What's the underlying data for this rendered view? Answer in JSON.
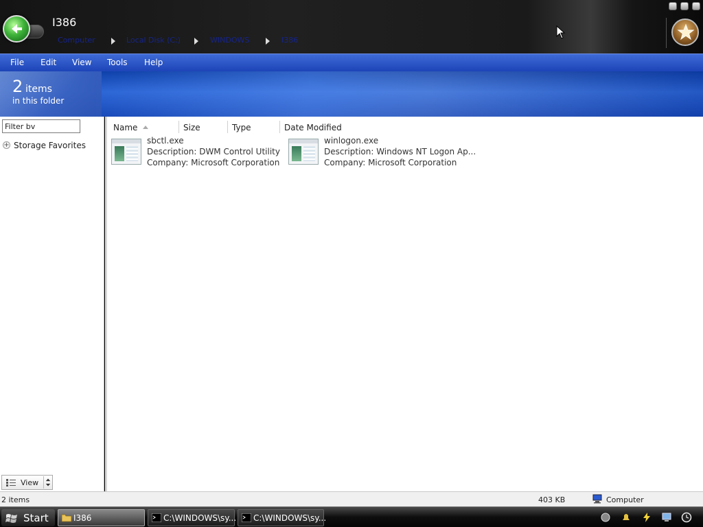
{
  "window": {
    "title": "I386",
    "breadcrumb": [
      "Computer",
      "Local Disk (C:)",
      "WINDOWS",
      "I386"
    ]
  },
  "menu": {
    "items": [
      "File",
      "Edit",
      "View",
      "Tools",
      "Help"
    ]
  },
  "header": {
    "count": "2",
    "count_word": "items",
    "subtitle": "in this folder"
  },
  "sidebar": {
    "filter_value": "Filter bv",
    "favorites_label": "Storage Favorites",
    "view_button_label": "View"
  },
  "columns": [
    "Name",
    "Size",
    "Type",
    "Date Modified"
  ],
  "files": [
    {
      "name": "sbctl.exe",
      "description": "Description: DWM Control Utility",
      "company": "Company: Microsoft Corporation"
    },
    {
      "name": "winlogon.exe",
      "description": "Description: Windows NT Logon Ap...",
      "company": "Company: Microsoft Corporation"
    }
  ],
  "status": {
    "count": "2 items",
    "size": "403 KB",
    "location": "Computer"
  },
  "taskbar": {
    "start_label": "Start",
    "tasks": [
      "I386",
      "C:\\WINDOWS\\sy...",
      "C:\\WINDOWS\\sy..."
    ]
  },
  "colors": {
    "menu_blue": "#1d44b8",
    "header_blue": "#2c66d6",
    "breadcrumb_link": "#15248a"
  }
}
